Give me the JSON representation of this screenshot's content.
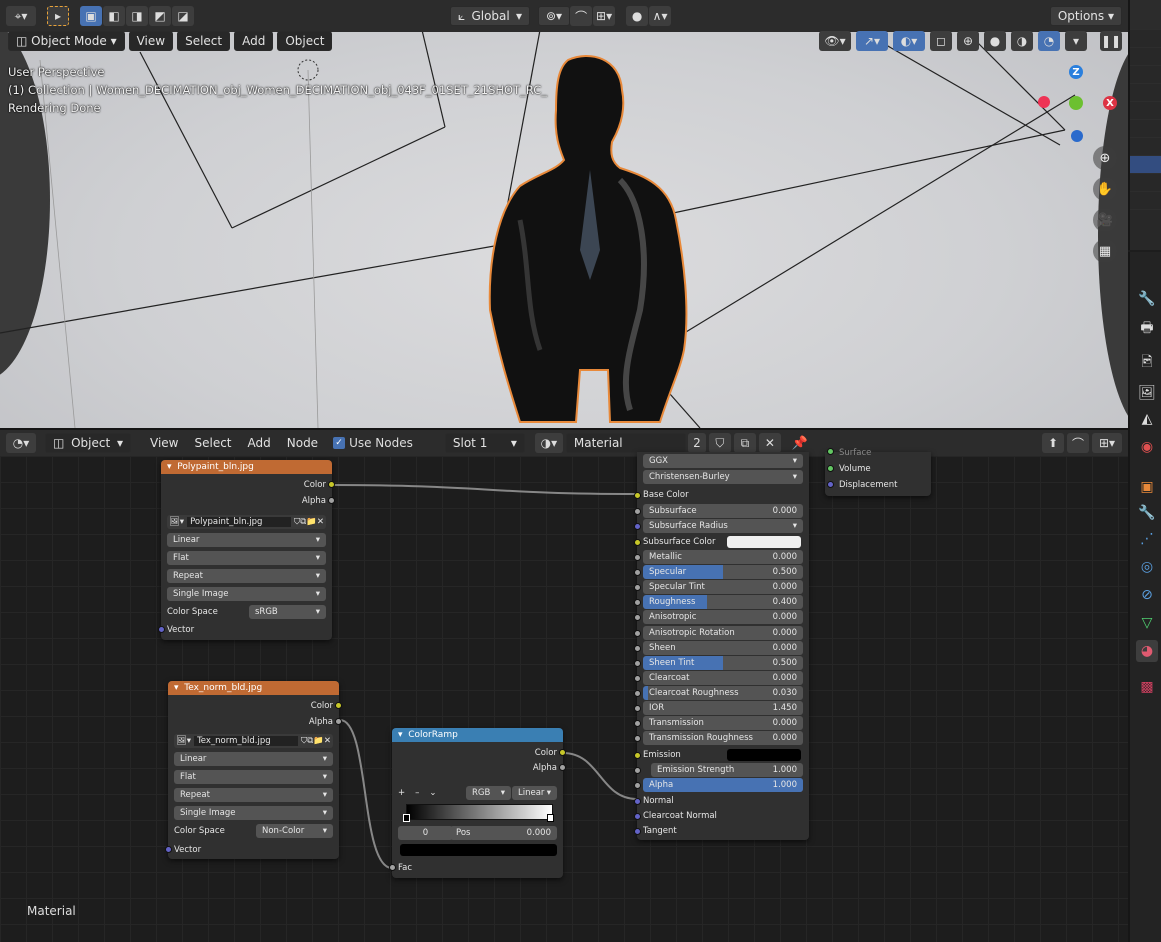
{
  "viewport": {
    "header": {
      "transform_orientation": "Global",
      "options_label": "Options"
    },
    "header2": {
      "mode": "Object Mode",
      "menus": [
        "View",
        "Select",
        "Add",
        "Object"
      ]
    },
    "info": {
      "perspective": "User Perspective",
      "collection": "(1) Collection | Women_DECIMATION_obj_Women_DECIMATION_obj_043F_01SET_21SHOT_RC_",
      "status": "Rendering Done"
    },
    "gizmo": {
      "z": "Z",
      "x": "X"
    }
  },
  "node_editor": {
    "header": {
      "editor_type": "Object",
      "menus": [
        "View",
        "Select",
        "Add",
        "Node"
      ],
      "use_nodes_label": "Use Nodes",
      "use_nodes_checked": true,
      "slot": "Slot 1",
      "material_name": "Material",
      "users": "2"
    },
    "footer_label": "Material",
    "image_node_1": {
      "title": "Polypaint_bln.jpg",
      "out_color": "Color",
      "out_alpha": "Alpha",
      "image": "Polypaint_bln.jpg",
      "interpolation": "Linear",
      "projection": "Flat",
      "extension": "Repeat",
      "source": "Single Image",
      "color_space_label": "Color Space",
      "color_space": "sRGB",
      "in_vector": "Vector"
    },
    "image_node_2": {
      "title": "Tex_norm_bld.jpg",
      "out_color": "Color",
      "out_alpha": "Alpha",
      "image": "Tex_norm_bld.jpg",
      "interpolation": "Linear",
      "projection": "Flat",
      "extension": "Repeat",
      "source": "Single Image",
      "color_space_label": "Color Space",
      "color_space": "Non-Color",
      "in_vector": "Vector"
    },
    "colorramp": {
      "title": "ColorRamp",
      "out_color": "Color",
      "out_alpha": "Alpha",
      "mode": "RGB",
      "interp": "Linear",
      "stop_index": "0",
      "pos_label": "Pos",
      "pos_value": "0.000",
      "in_fac": "Fac"
    },
    "bsdf": {
      "distribution": "GGX",
      "subsurface_method": "Christensen-Burley",
      "base_color": "Base Color",
      "subsurface": {
        "label": "Subsurface",
        "value": "0.000"
      },
      "subsurface_radius": "Subsurface Radius",
      "subsurface_color": "Subsurface Color",
      "sliders": [
        {
          "label": "Metallic",
          "value": "0.000",
          "fill": 0
        },
        {
          "label": "Specular",
          "value": "0.500",
          "fill": 0.5
        },
        {
          "label": "Specular Tint",
          "value": "0.000",
          "fill": 0
        },
        {
          "label": "Roughness",
          "value": "0.400",
          "fill": 0.4
        },
        {
          "label": "Anisotropic",
          "value": "0.000",
          "fill": 0
        },
        {
          "label": "Anisotropic Rotation",
          "value": "0.000",
          "fill": 0
        },
        {
          "label": "Sheen",
          "value": "0.000",
          "fill": 0
        },
        {
          "label": "Sheen Tint",
          "value": "0.500",
          "fill": 0.5
        },
        {
          "label": "Clearcoat",
          "value": "0.000",
          "fill": 0
        },
        {
          "label": "Clearcoat Roughness",
          "value": "0.030",
          "fill": 0.03
        },
        {
          "label": "IOR",
          "value": "1.450",
          "fill": 0
        },
        {
          "label": "Transmission",
          "value": "0.000",
          "fill": 0
        },
        {
          "label": "Transmission Roughness",
          "value": "0.000",
          "fill": 0
        }
      ],
      "emission": "Emission",
      "emission_strength": {
        "label": "Emission Strength",
        "value": "1.000"
      },
      "alpha": {
        "label": "Alpha",
        "value": "1.000",
        "fill": 1
      },
      "normal": "Normal",
      "clearcoat_normal": "Clearcoat Normal",
      "tangent": "Tangent"
    },
    "output_node": {
      "surface": "Surface",
      "volume": "Volume",
      "displacement": "Displacement"
    }
  },
  "colors": {
    "accent": "#4772b3",
    "texture_header": "#c06a33",
    "converter_header": "#3a7fb3",
    "socket_color": "#c7c729",
    "socket_vector": "#6363c7",
    "socket_float": "#a1a1a1",
    "selection_outline": "#e8893a"
  }
}
